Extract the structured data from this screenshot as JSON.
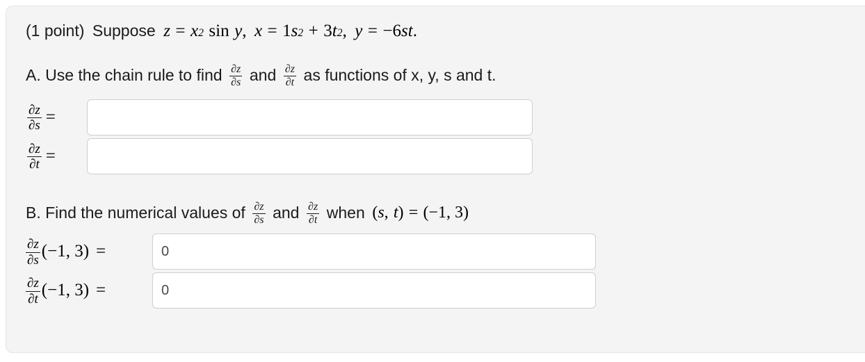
{
  "problem": {
    "points_label": "(1 point)",
    "intro_word": "Suppose",
    "statement_plain": "(1 point) Suppose z = x² sin y, x = 1s² + 3t², y = −6st.",
    "z_var": "z",
    "z_equals": "=",
    "x_var": "x",
    "x_exponent": "2",
    "sin_func": "sin",
    "y_var": "y",
    "comma1": ",",
    "x_def_var": "x",
    "x_def_equals": "=",
    "x_def_coeff": "1",
    "x_def_s": "s",
    "x_def_s_exp": "2",
    "x_def_plus": "+",
    "x_def_coeff2": "3",
    "x_def_t": "t",
    "x_def_t_exp": "2",
    "comma2": ",",
    "y_def_var": "y",
    "y_def_equals": "=",
    "y_def_rhs": "−6",
    "y_def_s": "s",
    "y_def_t": "t",
    "period": "."
  },
  "part_a": {
    "heading_prefix": "A. Use the chain rule to find",
    "heading_conjunction": "and",
    "heading_suffix": "as functions of x, y, s and t.",
    "heading_plain": "A. Use the chain rule to find ∂z/∂s and ∂z/∂t as functions of x, y, s and t.",
    "frac1": {
      "numerator": "∂z",
      "denominator": "∂s"
    },
    "frac2": {
      "numerator": "∂z",
      "denominator": "∂t"
    },
    "rows": [
      {
        "frac": {
          "numerator": "∂z",
          "denominator": "∂s"
        },
        "equals": "=",
        "value": "",
        "placeholder": ""
      },
      {
        "frac": {
          "numerator": "∂z",
          "denominator": "∂t"
        },
        "equals": "=",
        "value": "",
        "placeholder": ""
      }
    ]
  },
  "part_b": {
    "heading_prefix": "B. Find the numerical values of",
    "heading_conjunction": "and",
    "heading_suffix_when": "when",
    "heading_point": "(s, t) = (−1, 3).",
    "heading_plain": "B. Find the numerical values of ∂z/∂s and ∂z/∂t when (s, t) = (−1, 3).",
    "point_s_var": "s",
    "point_comma": ",",
    "point_t_var": "t",
    "point_equals": "=",
    "point_value": "(−1, 3)",
    "frac1": {
      "numerator": "∂z",
      "denominator": "∂s"
    },
    "frac2": {
      "numerator": "∂z",
      "denominator": "∂t"
    },
    "rows": [
      {
        "frac": {
          "numerator": "∂z",
          "denominator": "∂s"
        },
        "argument": "(−1, 3)",
        "equals": "=",
        "value": "0",
        "placeholder": ""
      },
      {
        "frac": {
          "numerator": "∂z",
          "denominator": "∂t"
        },
        "argument": "(−1, 3)",
        "equals": "=",
        "value": "0",
        "placeholder": ""
      }
    ]
  },
  "colors": {
    "card_background": "#f4f4f4",
    "card_border": "#e6e6e6",
    "page_background": "#ffffff",
    "text": "#1a1a1a",
    "input_background": "#ffffff",
    "input_border": "#cfcfcf",
    "input_value_text": "#4a4a4a"
  }
}
